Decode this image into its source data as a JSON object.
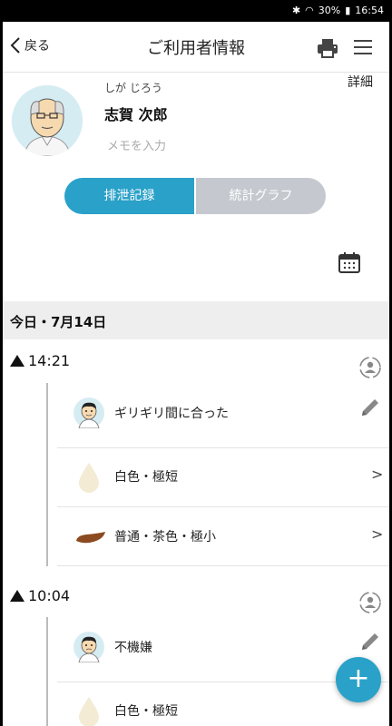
{
  "status_bar": {
    "battery": "30%",
    "time": "16:54"
  },
  "header": {
    "back_label": "戻る",
    "title": "ご利用者情報"
  },
  "profile": {
    "kana": "しが じろう",
    "name": "志賀 次郎",
    "memo_placeholder": "メモを入力",
    "detail_label": "詳細"
  },
  "tabs": [
    {
      "label": "排泄記録",
      "active": true
    },
    {
      "label": "統計グラフ",
      "active": false
    }
  ],
  "date_header": "今日・7月14日",
  "entries": [
    {
      "time": "14:21",
      "items": [
        {
          "type": "comment",
          "label": "ギリギリ間に合った"
        },
        {
          "type": "urine",
          "label": "白色・極短"
        },
        {
          "type": "stool",
          "label": "普通・茶色・極小"
        }
      ]
    },
    {
      "time": "10:04",
      "items": [
        {
          "type": "comment",
          "label": "不機嫌"
        },
        {
          "type": "urine",
          "label": "白色・極短"
        }
      ]
    }
  ],
  "colors": {
    "accent": "#2aa1c8",
    "inactive": "#c5c9cf",
    "band": "#eeeeee"
  },
  "fab_label": "+"
}
